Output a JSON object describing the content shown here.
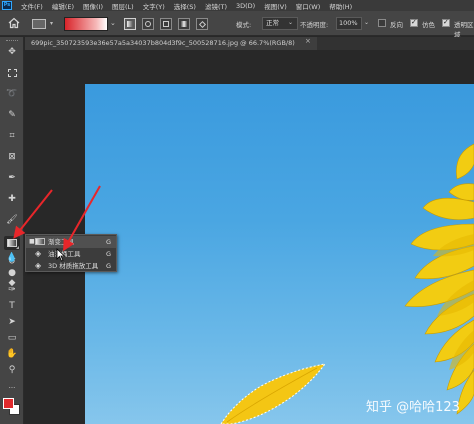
{
  "app": {
    "logo_text": "Ps"
  },
  "menu": [
    "文件(F)",
    "编辑(E)",
    "图像(I)",
    "图层(L)",
    "文字(Y)",
    "选择(S)",
    "滤镜(T)",
    "3D(D)",
    "视图(V)",
    "窗口(W)",
    "帮助(H)"
  ],
  "options": {
    "gradient_colors": [
      "#d9242a",
      "#f6b9b9",
      "#ffffff"
    ],
    "mode_label": "模式:",
    "mode_value": "正常",
    "opacity_label": "不透明度:",
    "opacity_value": "100%",
    "reverse_label": "反向",
    "reverse_checked": false,
    "dither_label": "仿色",
    "dither_checked": true,
    "transparency_label": "透明区域",
    "transparency_checked": true
  },
  "document": {
    "tab_title": "699pic_350723593e36e57a5a34037b804d3f9c_500528716.jpg @ 66.7%(RGB/8)"
  },
  "toolbar": {
    "tools": [
      "move-icon",
      "marquee-icon",
      "lasso-icon",
      "quick-select-icon",
      "crop-icon",
      "frame-icon",
      "eyedropper-icon",
      "healing-icon",
      "brush-icon",
      "stamp-icon",
      "history-brush-icon",
      "eraser-icon",
      "gradient-icon",
      "blur-icon",
      "dodge-icon",
      "pen-icon",
      "type-icon",
      "path-select-icon",
      "rectangle-icon",
      "hand-icon",
      "zoom-icon"
    ],
    "active_tool": "gradient-icon",
    "foreground_color": "#e12a2d",
    "background_color": "#ffffff"
  },
  "flyout": {
    "items": [
      {
        "bullet": "■",
        "label": "渐变工具",
        "key": "G",
        "icon": "gradient-icon"
      },
      {
        "bullet": "",
        "label": "油漆桶工具",
        "key": "G",
        "icon": "paint-bucket-icon"
      },
      {
        "bullet": "",
        "label": "3D 材质拖放工具",
        "key": "G",
        "icon": "3d-material-drop-icon"
      }
    ]
  },
  "watermark": "知乎 @哈哈123"
}
